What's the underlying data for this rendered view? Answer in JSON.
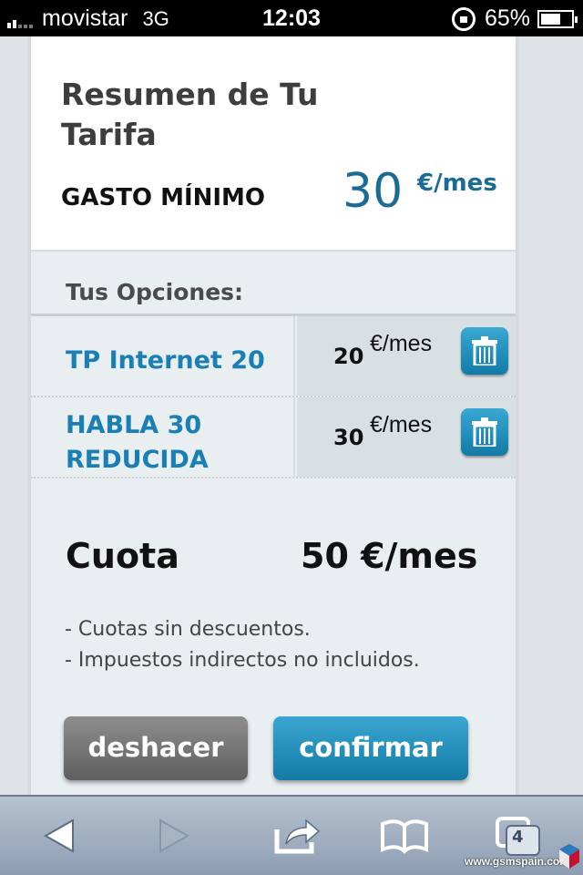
{
  "status_bar": {
    "carrier": "movistar",
    "network": "3G",
    "time": "12:03",
    "battery": "65%",
    "battery_level": 0.65
  },
  "summary": {
    "title": "Resumen de Tu Tarifa",
    "min_label": "GASTO MÍNIMO",
    "min_value": "30",
    "min_unit": "€/mes"
  },
  "options": {
    "heading": "Tus Opciones:",
    "items": [
      {
        "name": "TP Internet 20",
        "price": "20",
        "unit": "€/mes"
      },
      {
        "name": "HABLA 30 REDUCIDA",
        "price": "30",
        "unit": "€/mes"
      }
    ]
  },
  "total": {
    "label": "Cuota",
    "value": "50 €/mes"
  },
  "notes": [
    "- Cuotas sin descuentos.",
    "- Impuestos indirectos no incluidos."
  ],
  "actions": {
    "undo_label": "deshacer",
    "confirm_label": "confirmar"
  },
  "toolbar": {
    "tabs_count": "4"
  },
  "watermark": "www.gsmspain.com",
  "colors": {
    "accent": "#1a7fb4",
    "price_blue": "#1a6c95",
    "button_blue": "#137aa6",
    "button_gray": "#6f6f6f"
  }
}
